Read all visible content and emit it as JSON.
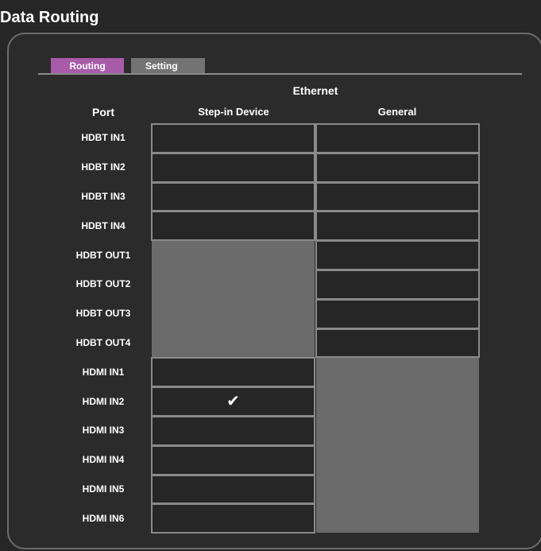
{
  "header": {
    "title": "Data Routing"
  },
  "tabs": [
    {
      "label": "Routing",
      "active": true
    },
    {
      "label": "Setting",
      "active": false
    }
  ],
  "table": {
    "group_header": "Ethernet",
    "port_header": "Port",
    "columns": [
      "Step-in Device",
      "General"
    ],
    "rows": [
      {
        "port": "HDBT IN1",
        "step_in": "",
        "general": ""
      },
      {
        "port": "HDBT IN2",
        "step_in": "",
        "general": ""
      },
      {
        "port": "HDBT IN3",
        "step_in": "",
        "general": ""
      },
      {
        "port": "HDBT IN4",
        "step_in": "",
        "general": ""
      },
      {
        "port": "HDBT OUT1",
        "step_in": "disabled",
        "general": ""
      },
      {
        "port": "HDBT OUT2",
        "step_in": "disabled",
        "general": ""
      },
      {
        "port": "HDBT OUT3",
        "step_in": "disabled",
        "general": ""
      },
      {
        "port": "HDBT OUT4",
        "step_in": "disabled",
        "general": ""
      },
      {
        "port": "HDMI IN1",
        "step_in": "",
        "general": "disabled"
      },
      {
        "port": "HDMI IN2",
        "step_in": "checked",
        "general": "disabled"
      },
      {
        "port": "HDMI IN3",
        "step_in": "",
        "general": "disabled"
      },
      {
        "port": "HDMI IN4",
        "step_in": "",
        "general": "disabled"
      },
      {
        "port": "HDMI IN5",
        "step_in": "",
        "general": "disabled"
      },
      {
        "port": "HDMI IN6",
        "step_in": "",
        "general": "disabled"
      }
    ],
    "check_glyph": "✔"
  },
  "colors": {
    "background": "#262626",
    "tab_active": "#a85ba8",
    "tab_inactive": "#737373",
    "disabled_cell": "#6b6b6b",
    "cell_border": "#8a8a8a"
  }
}
